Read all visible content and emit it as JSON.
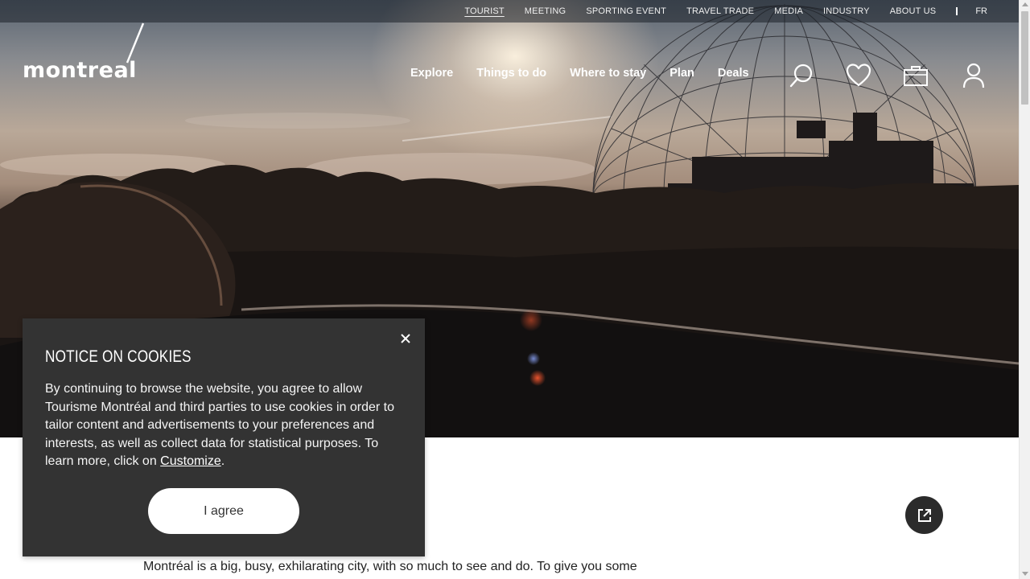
{
  "utility_nav": {
    "items": [
      {
        "label": "TOURIST",
        "active": true
      },
      {
        "label": "MEETING",
        "active": false
      },
      {
        "label": "SPORTING EVENT",
        "active": false
      },
      {
        "label": "TRAVEL TRADE",
        "active": false
      },
      {
        "label": "MEDIA",
        "active": false
      },
      {
        "label": "INDUSTRY",
        "active": false
      },
      {
        "label": "ABOUT US",
        "active": false
      }
    ],
    "language": "FR"
  },
  "logo": {
    "text": "montreal"
  },
  "main_nav": {
    "items": [
      "Explore",
      "Things to do",
      "Where to stay",
      "Plan",
      "Deals"
    ],
    "icons": [
      "search-icon",
      "heart-icon",
      "briefcase-icon",
      "user-icon"
    ]
  },
  "cookie_notice": {
    "title": "NOTICE ON COOKIES",
    "body_text": "By continuing to browse the website, you agree to allow Tourisme Montréal and third parties to use cookies in order to tailor content and advertisements to your preferences and interests, as well as collect data for statistical purposes. To learn more, click on ",
    "link_label": "Customize",
    "body_end": ".",
    "agree_label": "I agree",
    "close_icon": "close-icon"
  },
  "content": {
    "intro": "Montréal is a big, busy, exhilarating city, with so much to see and do. To give you some",
    "share_icon": "external-link-icon"
  },
  "colors": {
    "dialog_bg": "#333333",
    "share_button_bg": "#2b2b2b",
    "nav_text": "#ffffff"
  }
}
